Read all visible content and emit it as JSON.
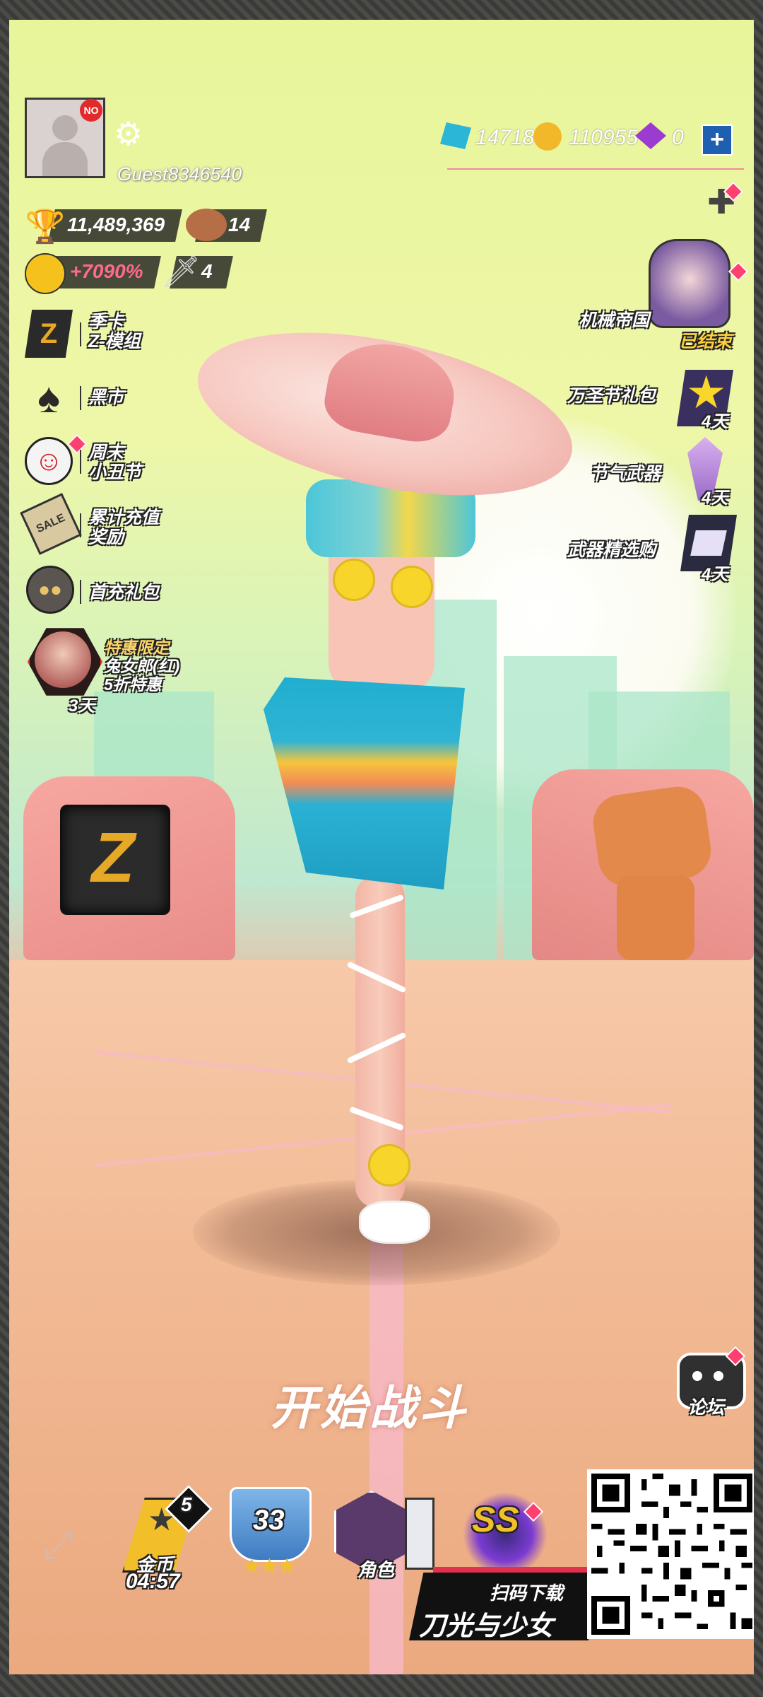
{
  "profile": {
    "username": "Guest8346540",
    "avatar_badge": "NO"
  },
  "stats": {
    "trophies": "11,489,369",
    "bears": "14",
    "bonus": "+7090%",
    "swords": "4"
  },
  "currency": {
    "gems": "14718",
    "gold": "110955",
    "cubes": "0"
  },
  "left_menu": [
    {
      "icon": "z-module-icon",
      "label_line1": "季卡",
      "label_line2": "Z-模组"
    },
    {
      "icon": "spade-icon",
      "label_line1": "黑市",
      "label_line2": ""
    },
    {
      "icon": "clown-icon",
      "label_line1": "周末",
      "label_line2": "小丑节"
    },
    {
      "icon": "sale-tag-icon",
      "label_line1": "累计充值",
      "label_line2": "奖励"
    },
    {
      "icon": "bomb-bot-icon",
      "label_line1": "首充礼包",
      "label_line2": ""
    }
  ],
  "special_offer": {
    "line1": "特惠限定",
    "line2": "兔女郎(红)",
    "line3": "5折特惠",
    "days": "3天"
  },
  "right_menu": {
    "mech_empire": "机械帝国",
    "mech_empire_status": "已结束",
    "halloween_pack": "万圣节礼包",
    "halloween_days": "4天",
    "festival_weapon": "节气武器",
    "festival_days": "4天",
    "weapon_selection": "武器精选购",
    "weapon_days": "4天"
  },
  "main": {
    "start_battle": "开始战斗",
    "forum": "论坛"
  },
  "bottom_bar": {
    "gold_label": "金币",
    "gold_timer": "04:57",
    "gold_badge": "5",
    "level": "33",
    "character_label": "角色",
    "rank": "SS"
  },
  "promo": {
    "scan_download": "扫码下载",
    "game_title": "刀光与少女"
  },
  "colors": {
    "accent_pink": "#ff3f6e",
    "gold": "#e6a827",
    "plus_blue": "#1f5fb1"
  }
}
